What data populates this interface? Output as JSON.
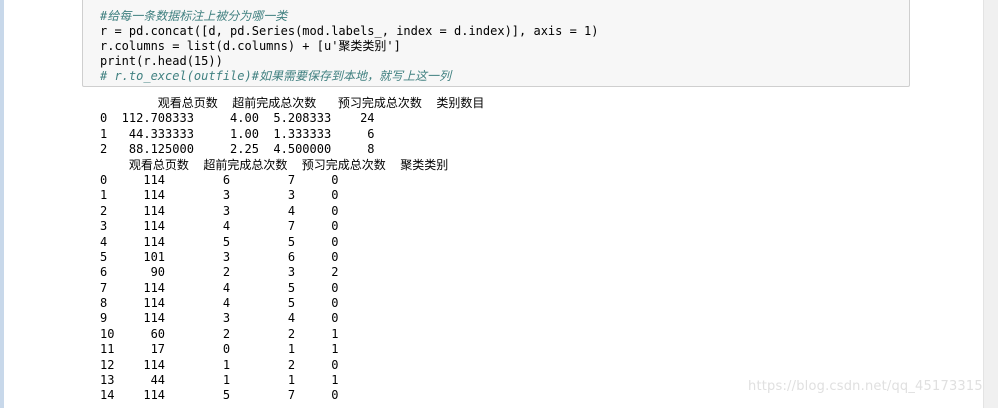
{
  "code_cell": {
    "lines": [
      "#给每一条数据标注上被分为哪一类",
      "r = pd.concat([d, pd.Series(mod.labels_, index = d.index)], axis = 1)",
      "r.columns = list(d.columns) + [u'聚类类别']",
      "print(r.head(15))",
      "# r.to_excel(outfile)#如果需要保存到本地，就写上这一列"
    ]
  },
  "output": {
    "summary_lines": [
      "        观看总页数  超前完成总次数   预习完成总次数  类别数目",
      "0  112.708333     4.00  5.208333    24",
      "1   44.333333     1.00  1.333333     6",
      "2   88.125000     2.25  4.500000     8"
    ],
    "table_lines": [
      "    观看总页数  超前完成总次数  预习完成总次数  聚类类别",
      "0     114        6        7     0",
      "1     114        3        3     0",
      "2     114        3        4     0",
      "3     114        4        7     0",
      "4     114        5        5     0",
      "5     101        3        6     0",
      "6      90        2        3     2",
      "7     114        4        5     0",
      "8     114        4        5     0",
      "9     114        3        4     0",
      "10     60        2        2     1",
      "11     17        0        1     1",
      "12    114        1        2     0",
      "13     44        1        1     1",
      "14    114        5        7     0"
    ]
  },
  "watermark": "https://blog.csdn.net/qq_45173315"
}
